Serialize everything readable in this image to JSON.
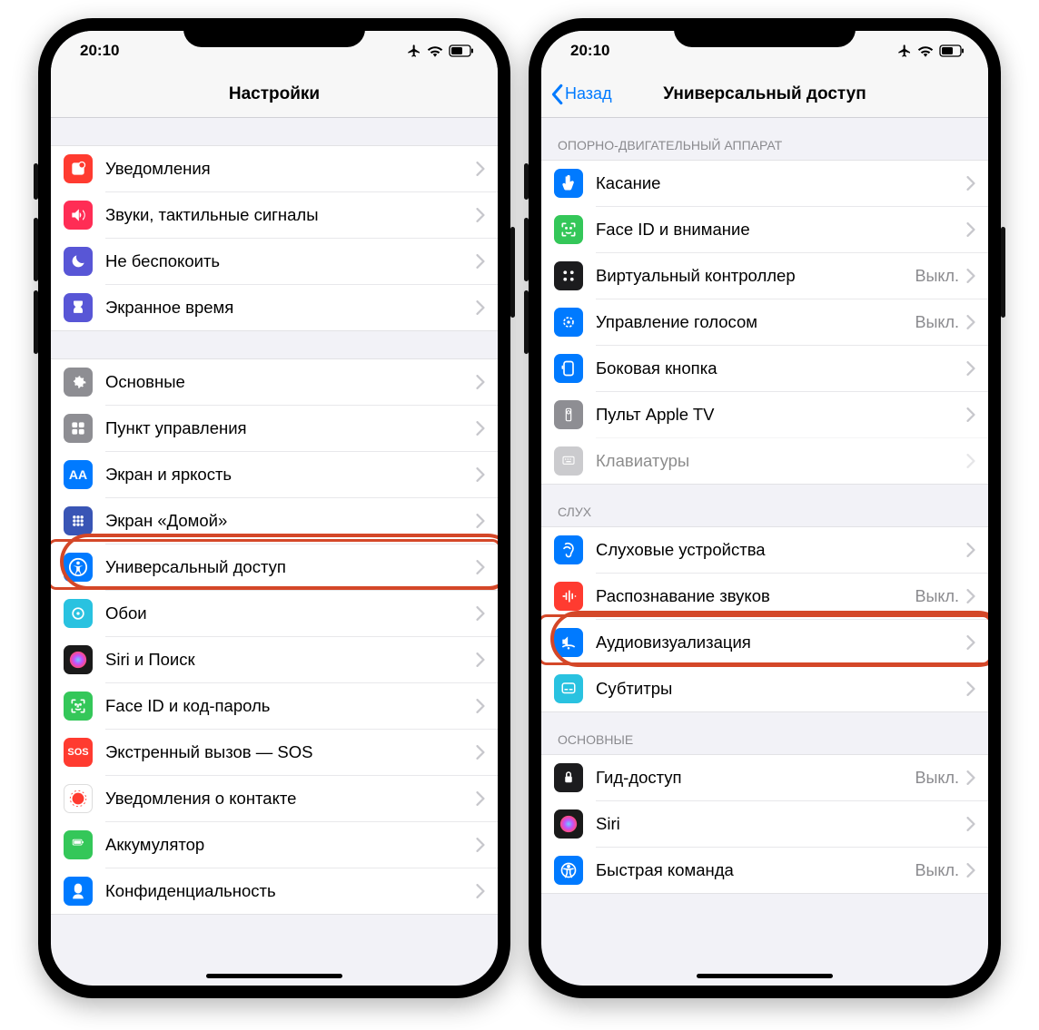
{
  "status": {
    "time": "20:10"
  },
  "left": {
    "title": "Настройки",
    "group1": [
      {
        "icon": "notifications-icon",
        "bg": "#ff3b30",
        "label": "Уведомления"
      },
      {
        "icon": "sounds-icon",
        "bg": "#ff2d55",
        "label": "Звуки, тактильные сигналы"
      },
      {
        "icon": "dnd-icon",
        "bg": "#5856d6",
        "label": "Не беспокоить"
      },
      {
        "icon": "screentime-icon",
        "bg": "#5856d6",
        "label": "Экранное время"
      }
    ],
    "group2": [
      {
        "icon": "general-icon",
        "bg": "#8e8e93",
        "label": "Основные"
      },
      {
        "icon": "control-center-icon",
        "bg": "#8e8e93",
        "label": "Пункт управления"
      },
      {
        "icon": "display-icon",
        "bg": "#007aff",
        "label": "Экран и яркость"
      },
      {
        "icon": "home-screen-icon",
        "bg": "#3955b5",
        "label": "Экран «Домой»"
      },
      {
        "icon": "accessibility-icon",
        "bg": "#007aff",
        "label": "Универсальный доступ"
      },
      {
        "icon": "wallpaper-icon",
        "bg": "#29c2e0",
        "label": "Обои"
      },
      {
        "icon": "siri-icon",
        "bg": "#1a1a1a",
        "label": "Siri и Поиск"
      },
      {
        "icon": "faceid-icon",
        "bg": "#34c759",
        "label": "Face ID и код-пароль"
      },
      {
        "icon": "sos-icon",
        "bg": "#ff3b30",
        "label": "Экстренный вызов — SOS",
        "text": "SOS"
      },
      {
        "icon": "exposure-icon",
        "bg": "#ffffff",
        "label": "Уведомления о контакте"
      },
      {
        "icon": "battery-icon",
        "bg": "#34c759",
        "label": "Аккумулятор"
      },
      {
        "icon": "privacy-icon",
        "bg": "#007aff",
        "label": "Конфиденциальность"
      }
    ]
  },
  "right": {
    "back": "Назад",
    "title": "Универсальный доступ",
    "section1_header": "ОПОРНО-ДВИГАТЕЛЬНЫЙ АППАРАТ",
    "group1": [
      {
        "icon": "touch-icon",
        "bg": "#007aff",
        "label": "Касание"
      },
      {
        "icon": "faceid-attention-icon",
        "bg": "#34c759",
        "label": "Face ID и внимание"
      },
      {
        "icon": "switch-control-icon",
        "bg": "#1c1c1e",
        "label": "Виртуальный контроллер",
        "value": "Выкл."
      },
      {
        "icon": "voice-control-icon",
        "bg": "#007aff",
        "label": "Управление голосом",
        "value": "Выкл."
      },
      {
        "icon": "side-button-icon",
        "bg": "#007aff",
        "label": "Боковая кнопка"
      },
      {
        "icon": "apple-tv-remote-icon",
        "bg": "#8e8e93",
        "label": "Пульт Apple TV"
      },
      {
        "icon": "keyboards-icon",
        "bg": "#8e8e93",
        "label": "Клавиатуры",
        "fade": true
      }
    ],
    "section2_header": "СЛУХ",
    "group2": [
      {
        "icon": "hearing-devices-icon",
        "bg": "#007aff",
        "label": "Слуховые устройства"
      },
      {
        "icon": "sound-rec-icon",
        "bg": "#ff3b30",
        "label": "Распознавание звуков",
        "value": "Выкл."
      },
      {
        "icon": "audio-visual-icon",
        "bg": "#007aff",
        "label": "Аудиовизуализация"
      },
      {
        "icon": "subtitles-icon",
        "bg": "#29c2e0",
        "label": "Субтитры"
      }
    ],
    "section3_header": "ОСНОВНЫЕ",
    "group3": [
      {
        "icon": "guided-access-icon",
        "bg": "#1c1c1e",
        "label": "Гид-доступ",
        "value": "Выкл."
      },
      {
        "icon": "siri-icon2",
        "bg": "#1a1a1a",
        "label": "Siri"
      },
      {
        "icon": "shortcut-icon",
        "bg": "#007aff",
        "label": "Быстрая команда",
        "value": "Выкл."
      }
    ]
  }
}
